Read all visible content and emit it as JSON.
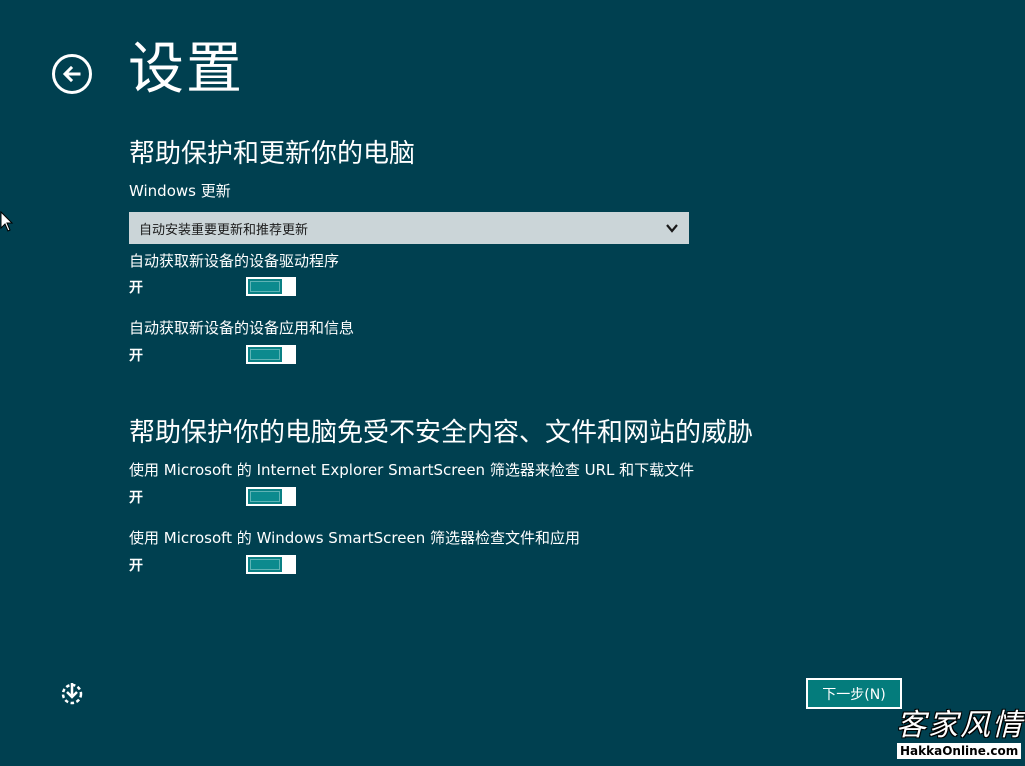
{
  "page": {
    "title": "设置"
  },
  "section_update": {
    "title": "帮助保护和更新你的电脑",
    "windows_update_label": "Windows 更新",
    "windows_update_value": "自动安装重要更新和推荐更新",
    "drivers_label": "自动获取新设备的设备驱动程序",
    "drivers_state": "开",
    "apps_label": "自动获取新设备的设备应用和信息",
    "apps_state": "开"
  },
  "section_security": {
    "title": "帮助保护你的电脑免受不安全内容、文件和网站的威胁",
    "ie_smartscreen_label": "使用 Microsoft 的 Internet Explorer SmartScreen 筛选器来检查 URL 和下载文件",
    "ie_smartscreen_state": "开",
    "win_smartscreen_label": "使用 Microsoft 的 Windows SmartScreen 筛选器检查文件和应用",
    "win_smartscreen_state": "开"
  },
  "footer": {
    "next_label": "下一步(N)"
  },
  "watermark": {
    "chinese": "客家风情",
    "url": "HakkaOnline.com"
  },
  "icons": {
    "back": "back-arrow-icon",
    "dropdown": "chevron-down-icon",
    "ease_of_access": "ease-of-access-icon",
    "cursor": "mouse-cursor-icon"
  },
  "colors": {
    "background": "#004050",
    "toggle_on": "#0a8084",
    "dropdown_bg": "#cbd5d8",
    "button_bg": "#047c7c"
  }
}
